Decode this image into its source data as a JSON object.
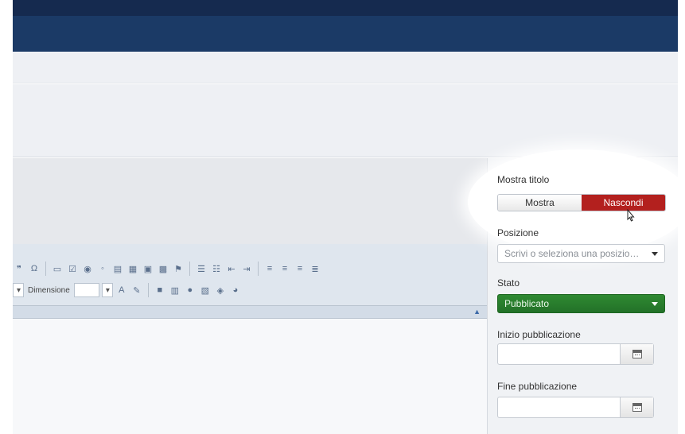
{
  "editor": {
    "toolbar_row1_icons": [
      "quote-icon",
      "omega-icon",
      "textfield-icon",
      "checkbox-icon",
      "radio-icon",
      "button-icon",
      "form-icon",
      "image-field-icon",
      "hidden-field-icon",
      "image-insert-icon",
      "anchor-icon",
      "ordered-list-icon",
      "unordered-list-icon",
      "outdent-icon",
      "indent-icon",
      "align-left-icon",
      "align-center-icon",
      "align-right-icon",
      "justify-icon"
    ],
    "toolbar_row2_icons": [
      "text-color-icon",
      "bg-color-icon",
      "flash-icon",
      "table-icon",
      "info-icon",
      "page-break-icon",
      "special-icon",
      "color-wheel-icon"
    ],
    "size_label": "Dimensione",
    "collapse_glyph": "▲"
  },
  "sidebar": {
    "mostra_titolo": {
      "label": "Mostra titolo",
      "options": [
        "Mostra",
        "Nascondi"
      ],
      "selected": "Nascondi"
    },
    "posizione": {
      "label": "Posizione",
      "placeholder": "Scrivi o seleziona una posizio…"
    },
    "stato": {
      "label": "Stato",
      "value": "Pubblicato",
      "color": "#2b7d2f"
    },
    "inizio_pubblicazione": {
      "label": "Inizio pubblicazione",
      "value": ""
    },
    "fine_pubblicazione": {
      "label": "Fine pubblicazione",
      "value": ""
    }
  },
  "colors": {
    "header": "#1b3a66",
    "toggle_active": "#b3201e"
  }
}
